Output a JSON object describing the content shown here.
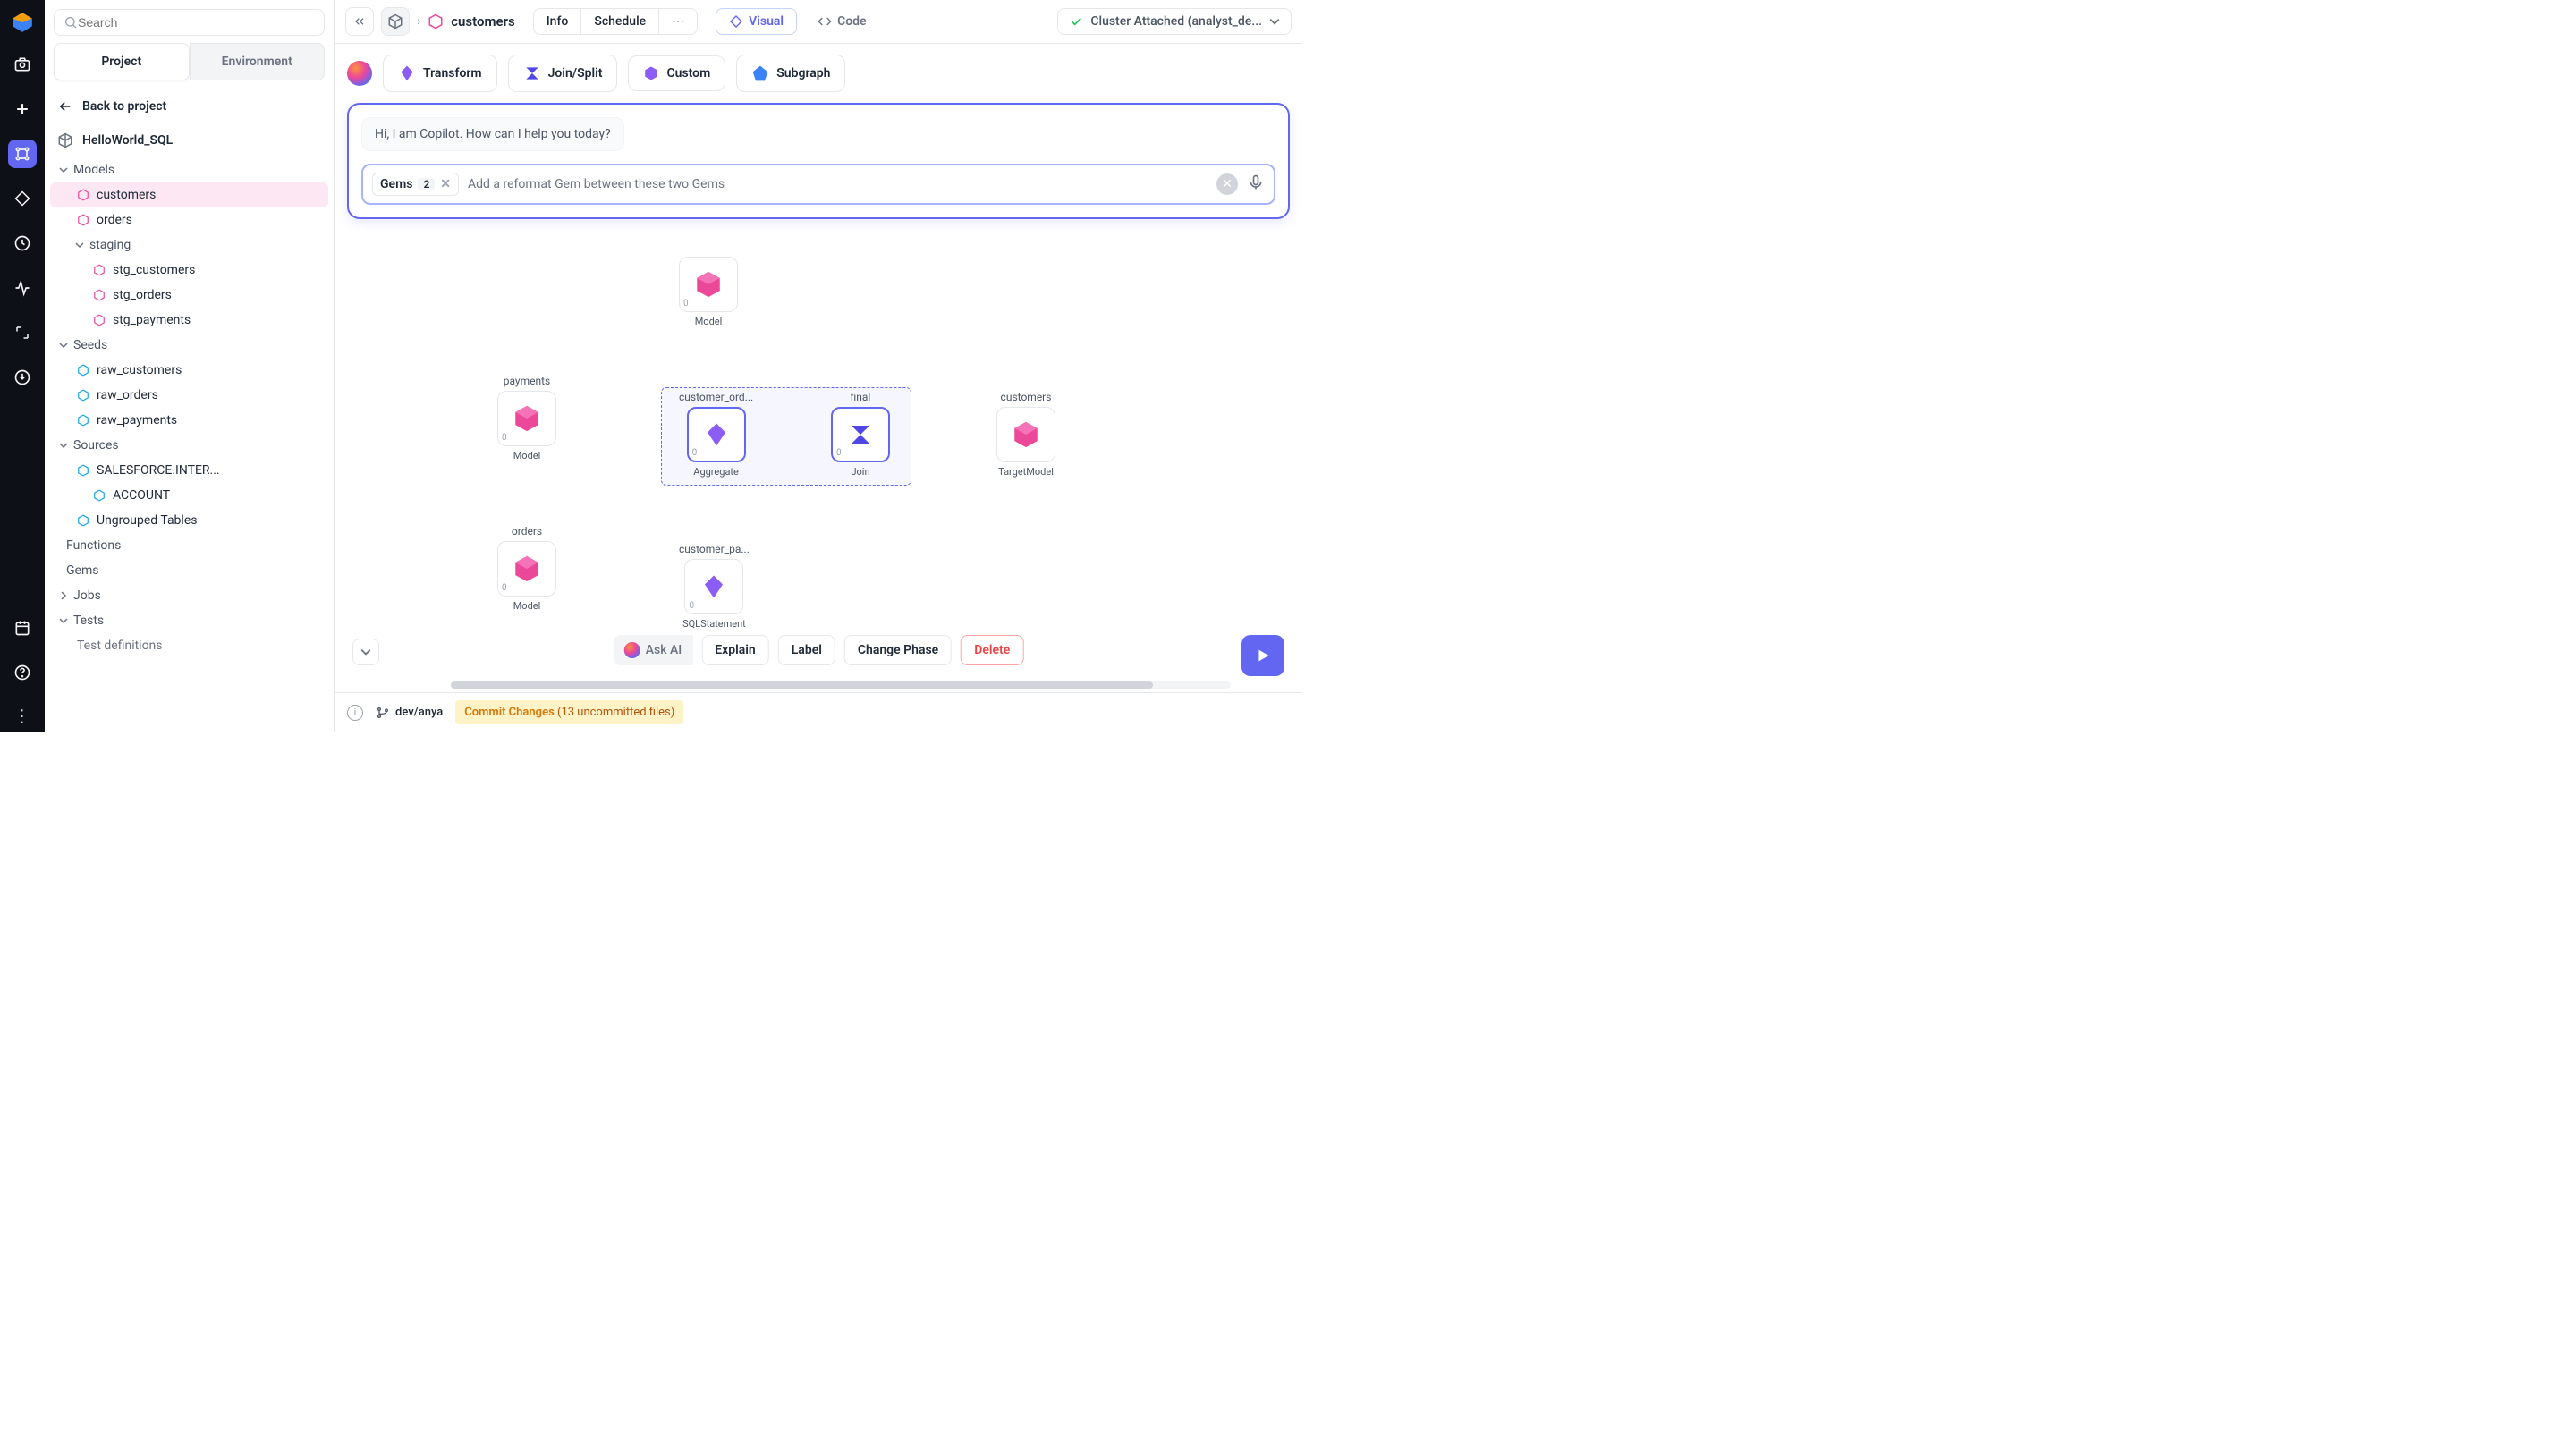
{
  "search": {
    "placeholder": "Search"
  },
  "tabs": {
    "project": "Project",
    "environment": "Environment"
  },
  "back": "Back to project",
  "projectName": "HelloWorld_SQL",
  "tree": {
    "models": "Models",
    "customers": "customers",
    "orders": "orders",
    "staging": "staging",
    "stg_customers": "stg_customers",
    "stg_orders": "stg_orders",
    "stg_payments": "stg_payments",
    "seeds": "Seeds",
    "raw_customers": "raw_customers",
    "raw_orders": "raw_orders",
    "raw_payments": "raw_payments",
    "sources": "Sources",
    "salesforce": "SALESFORCE.INTER...",
    "account": "ACCOUNT",
    "ungrouped": "Ungrouped Tables",
    "functions": "Functions",
    "gems": "Gems",
    "jobs": "Jobs",
    "tests": "Tests",
    "testdefs": "Test definitions"
  },
  "breadcrumb": {
    "name": "customers"
  },
  "topPills": {
    "info": "Info",
    "schedule": "Schedule"
  },
  "views": {
    "visual": "Visual",
    "code": "Code"
  },
  "cluster": "Cluster Attached (analyst_de...",
  "toolbar": {
    "transform": "Transform",
    "joinsplit": "Join/Split",
    "custom": "Custom",
    "subgraph": "Subgraph"
  },
  "copilot": {
    "greeting": "Hi, I am Copilot. How can I help you today?",
    "chipLabel": "Gems",
    "chipCount": "2",
    "placeholder": "Add a reformat Gem between these two Gems"
  },
  "nodes": {
    "n1": {
      "label": "",
      "type": "Model",
      "count": "0"
    },
    "n2": {
      "label": "payments",
      "type": "Model",
      "count": "0"
    },
    "n3": {
      "label": "orders",
      "type": "Model",
      "count": "0"
    },
    "n4": {
      "label": "customer_ord...",
      "type": "Aggregate",
      "count": "0"
    },
    "n5": {
      "label": "customer_pa...",
      "type": "SQLStatement",
      "count": "0"
    },
    "n6": {
      "label": "final",
      "type": "Join",
      "count": "0"
    },
    "n7": {
      "label": "customers",
      "type": "TargetModel",
      "count": ""
    }
  },
  "actions": {
    "askai": "Ask AI",
    "explain": "Explain",
    "label": "Label",
    "changePhase": "Change Phase",
    "delete": "Delete"
  },
  "status": {
    "branch": "dev/anya",
    "commitA": "Commit Changes ",
    "commitB": "(13 uncommitted files)"
  }
}
